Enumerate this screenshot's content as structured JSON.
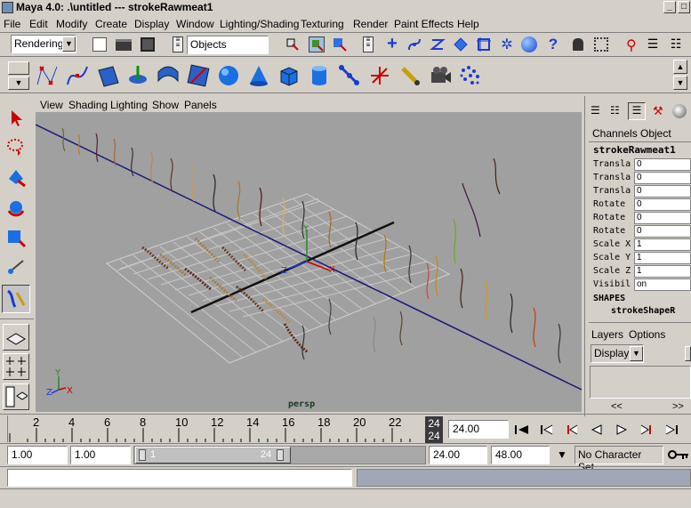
{
  "window": {
    "title": "Maya 4.0: .\\untitled   ---   strokeRawmeat1"
  },
  "menu": [
    "File",
    "Edit",
    "Modify",
    "Create",
    "Display",
    "Window",
    "Lighting/Shading",
    "Texturing",
    "Render",
    "Paint Effects",
    "Help"
  ],
  "toolbar": {
    "mode": "Rendering",
    "selection_mask": "Objects"
  },
  "panel_menu": [
    "View",
    "Shading",
    "Lighting",
    "Show",
    "Panels"
  ],
  "viewport": {
    "camera_label": "persp",
    "axis_labels": {
      "x": "X",
      "y": "Y",
      "z": "Z"
    }
  },
  "channels": {
    "tabs": [
      "Channels",
      "Object"
    ],
    "object_name": "strokeRawmeat1",
    "attributes": [
      {
        "label": "Transla",
        "value": "0"
      },
      {
        "label": "Transla",
        "value": "0"
      },
      {
        "label": "Transla",
        "value": "0"
      },
      {
        "label": "Rotate",
        "value": "0"
      },
      {
        "label": "Rotate",
        "value": "0"
      },
      {
        "label": "Rotate",
        "value": "0"
      },
      {
        "label": "Scale X",
        "value": "1"
      },
      {
        "label": "Scale Y",
        "value": "1"
      },
      {
        "label": "Scale Z",
        "value": "1"
      },
      {
        "label": "Visibil",
        "value": "on"
      }
    ],
    "shapes_header": "SHAPES",
    "shape_name": "strokeShapeR"
  },
  "layers": {
    "menu": [
      "Layers",
      "Options"
    ],
    "display_value": "Display",
    "nav_left": "<<",
    "nav_right": ">>"
  },
  "timeline": {
    "ticks": [
      "2",
      "4",
      "6",
      "8",
      "10",
      "12",
      "14",
      "16",
      "18",
      "20",
      "22"
    ],
    "current_frame_top": "24",
    "current_frame_bottom": "24",
    "current_time": "24.00"
  },
  "range": {
    "start": "1.00",
    "playback_start": "1.00",
    "slider_left": "1",
    "slider_right": "24",
    "playback_end": "24.00",
    "end": "48.00",
    "character_set": "No Character Set"
  }
}
